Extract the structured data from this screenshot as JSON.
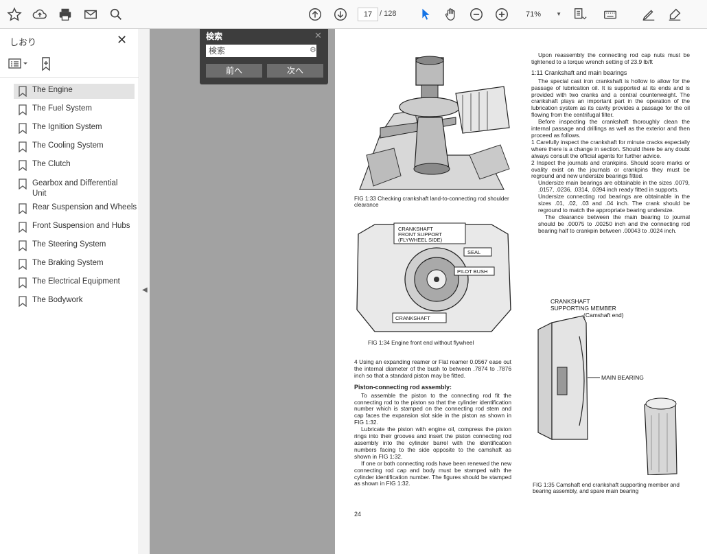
{
  "toolbar": {
    "current_page": "17",
    "total_pages": "/ 128",
    "zoom": "71%",
    "icons": [
      "star-icon",
      "cloud-upload-icon",
      "print-icon",
      "mail-icon",
      "zoom-search-icon",
      "page-up-icon",
      "page-down-icon",
      "select-arrow-icon",
      "hand-icon",
      "zoom-out-icon",
      "zoom-in-icon",
      "page-fit-icon",
      "keyboard-icon",
      "pen-icon",
      "sign-icon"
    ]
  },
  "sidebar": {
    "title": "しおり",
    "bookmarks": [
      {
        "label": "The Engine"
      },
      {
        "label": "The Fuel System"
      },
      {
        "label": "The Ignition System"
      },
      {
        "label": "The Cooling System"
      },
      {
        "label": "The Clutch"
      },
      {
        "label": "Gearbox and Differential Unit"
      },
      {
        "label": "Rear Suspension and Wheels"
      },
      {
        "label": "Front Suspension and Hubs"
      },
      {
        "label": "The Steering System"
      },
      {
        "label": "The Braking System"
      },
      {
        "label": "The Electrical Equipment"
      },
      {
        "label": "The Bodywork"
      }
    ]
  },
  "search": {
    "title": "検索",
    "placeholder": "検索",
    "prev": "前へ",
    "next": "次へ"
  },
  "doc": {
    "fig133_caption": "FIG 1:33  Checking crankshaft land-to-connecting rod shoulder clearance",
    "fig134_caption": "FIG 1:34  Engine front end without flywheel",
    "fig134_labels": {
      "support": "CRANKSHAFT FRONT SUPPORT (FLYWHEEL SIDE)",
      "seal": "SEAL",
      "pilot": "PILOT BUSH",
      "crank": "CRANKSHAFT"
    },
    "left_step4": "4  Using an expanding reamer or Flat reamer 0.0567 ease out the internal diameter of the bush to between .7874 to .7876 inch so that a standard piston may be fitted.",
    "left_heading": "Piston-connecting rod assembly:",
    "left_p1": "To assemble the piston to the connecting rod fit the connecting rod to the piston so that the cylinder identification number which is stamped on the connecting rod stem and cap faces the expansion slot side in the piston as shown in FIG 1:32.",
    "left_p2": "Lubricate the piston with engine oil, compress the piston rings into their grooves and insert the piston connecting rod assembly into the cylinder barrel with the identification numbers facing to the side opposite to the camshaft as shown in FIG 1:32.",
    "left_p3": "If one or both connecting rods have been renewed the new connecting rod cap and body must be stamped with the cylinder identification number. The figures should be stamped as shown in FIG 1:32.",
    "page_number": "24",
    "right_p0": "Upon reassembly the connecting rod cap nuts must be tightened to a torque wrench setting of 23.9 lb/ft",
    "right_heading": "1:11  Crankshaft and main bearings",
    "right_p1": "The special cast iron crankshaft is hollow to allow for the passage of lubrication oil. It is supported at its ends and is provided with two cranks and a central counterweight. The crankshaft plays an important part in the operation of the lubrication system as its cavity provides a passage for the oil flowing from the centrifugal filter.",
    "right_p2": "Before inspecting the crankshaft thoroughly clean the internal passage and drillings as well as the exterior and then proceed as follows.",
    "right_step1": "1  Carefully inspect the crankshaft for minute cracks especially where there is a change in section. Should there be any doubt always consult the official agents for further advice.",
    "right_step2": "2  Inspect the journals and crankpins. Should score marks or ovality exist on the journals or crankpins they must be reground and new undersize bearings fitted.",
    "right_p3": "Undersize main bearings are obtainable in the sizes .0079, .0157, .0236, .0314, .0394 inch ready fitted in supports.",
    "right_p4": "Undersize connecting rod bearings are obtainable in the sizes .01, .02, .03 and .04 inch. The crank should be reground to match the appropriate bearing undersize.",
    "right_p5": "The clearance between the main bearing to journal should be .00075 to .00250 inch and the connecting rod bearing half to crankpin between .00043 to .0024 inch.",
    "fig135_labels": {
      "member": "CRANKSHAFT SUPPORTING MEMBER (Camshaft end)",
      "main": "MAIN BEARING"
    },
    "fig135_caption": "FIG 1:35  Camshaft end crankshaft supporting member and bearing assembly, and spare main bearing"
  }
}
